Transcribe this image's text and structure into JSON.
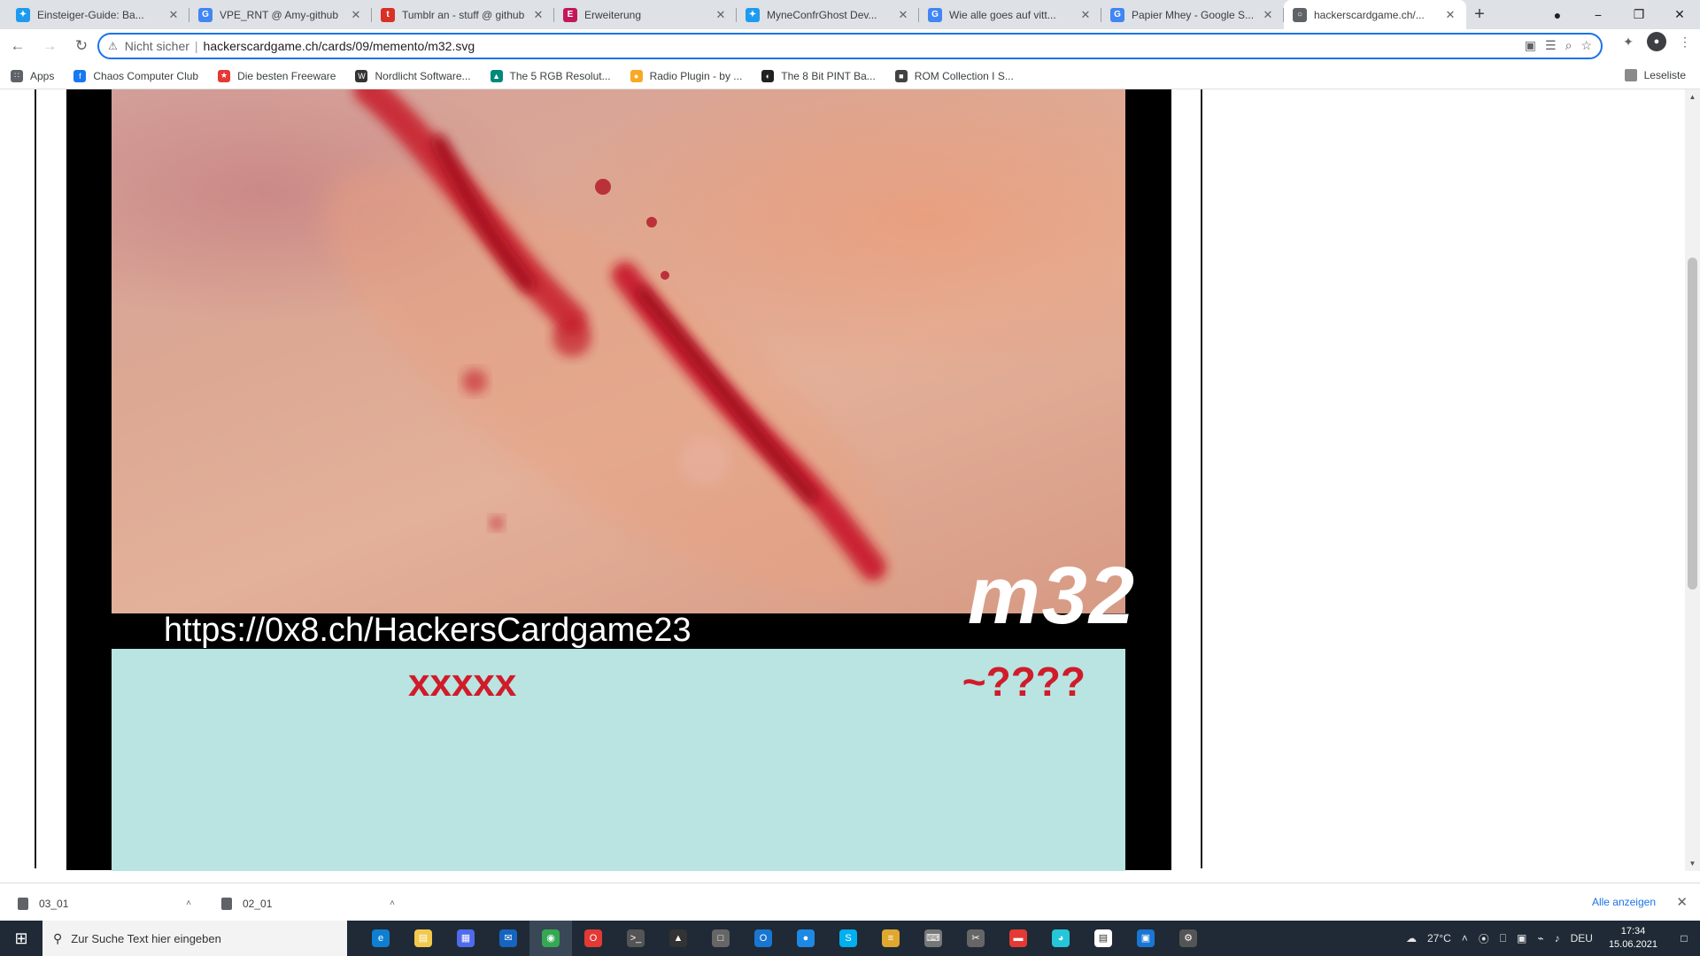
{
  "browser": {
    "tabs": [
      {
        "title": "Einsteiger-Guide: Ba...",
        "favicon_color": "#1d9bf0",
        "favicon_glyph": "✦",
        "active": false
      },
      {
        "title": "VPE_RNT @ Amy-github",
        "favicon_color": "#4285f4",
        "favicon_glyph": "G",
        "active": false
      },
      {
        "title": "Tumblr an - stuff @ github",
        "favicon_color": "#d93025",
        "favicon_glyph": "t",
        "active": false
      },
      {
        "title": "Erweiterung",
        "favicon_color": "#c2185b",
        "favicon_glyph": "E",
        "active": false
      },
      {
        "title": "MyneConfrGhost Dev...",
        "favicon_color": "#1d9bf0",
        "favicon_glyph": "✦",
        "active": false
      },
      {
        "title": "Wie alle goes auf vitt...",
        "favicon_color": "#4285f4",
        "favicon_glyph": "G",
        "active": false
      },
      {
        "title": "Papier Mhey - Google S...",
        "favicon_color": "#4285f4",
        "favicon_glyph": "G",
        "active": false
      },
      {
        "title": "hackerscardgame.ch/...",
        "favicon_color": "#5f6368",
        "favicon_glyph": "○",
        "active": true
      }
    ],
    "new_tab_glyph": "+",
    "window_controls": [
      "−",
      "❐",
      "✕"
    ],
    "nav": {
      "back": "←",
      "forward": "→",
      "reload": "↻"
    },
    "address": {
      "lock_glyph": "⚠",
      "security_label": "Nicht sicher",
      "separator": "|",
      "url": "hackerscardgame.ch/cards/09/memento/m32.svg"
    },
    "omnibox_icons": [
      "▣",
      "☰",
      "⌕",
      "☆"
    ],
    "toolbar_icons": [
      "✦",
      "●",
      "⋮"
    ],
    "bookmarks": [
      {
        "label": "Apps",
        "color": "#5f6368",
        "glyph": "∷"
      },
      {
        "label": "Chaos Computer Club",
        "color": "#1877f2",
        "glyph": "f"
      },
      {
        "label": "Die besten Freeware",
        "color": "#e53935",
        "glyph": "★"
      },
      {
        "label": "Nordlicht Software...",
        "color": "#333333",
        "glyph": "W"
      },
      {
        "label": "The 5 RGB Resolut...",
        "color": "#00897b",
        "glyph": "▲"
      },
      {
        "label": "Radio Plugin - by ...",
        "color": "#f9a825",
        "glyph": "●"
      },
      {
        "label": "The 8 Bit PINT Ba...",
        "color": "#212121",
        "glyph": "◐"
      },
      {
        "label": "ROM Collection I S...",
        "color": "#424242",
        "glyph": "■"
      }
    ],
    "bookmarks_right": "Leseliste"
  },
  "card": {
    "code": "m32",
    "url": "https://0x8.ch/HackersCardgame23",
    "info_left": "xxxxx",
    "info_right": "~????"
  },
  "downloads": [
    {
      "name": "03_01"
    },
    {
      "name": "02_01"
    }
  ],
  "downloads_show_all": "Alle anzeigen",
  "downloads_close": "✕",
  "taskbar": {
    "start_glyph": "⊞",
    "search_placeholder": "Zur Suche Text hier eingeben",
    "apps": [
      {
        "name": "edge",
        "color": "#0e7fd1",
        "glyph": "e"
      },
      {
        "name": "explorer",
        "color": "#f2c94c",
        "glyph": "▤"
      },
      {
        "name": "store",
        "color": "#4f6bed",
        "glyph": "▦"
      },
      {
        "name": "mail",
        "color": "#1565c0",
        "glyph": "✉"
      },
      {
        "name": "chrome",
        "color": "#34a853",
        "glyph": "◉"
      },
      {
        "name": "opera",
        "color": "#e53935",
        "glyph": "O"
      },
      {
        "name": "terminal",
        "color": "#555555",
        "glyph": ">_"
      },
      {
        "name": "dev",
        "color": "#333333",
        "glyph": "▲"
      },
      {
        "name": "vm",
        "color": "#666666",
        "glyph": "□"
      },
      {
        "name": "outlook",
        "color": "#1976d2",
        "glyph": "O"
      },
      {
        "name": "browser",
        "color": "#1e88e5",
        "glyph": "●"
      },
      {
        "name": "skype",
        "color": "#00aff0",
        "glyph": "S"
      },
      {
        "name": "notes",
        "color": "#e0a82e",
        "glyph": "≡"
      },
      {
        "name": "keyboard",
        "color": "#777777",
        "glyph": "⌨"
      },
      {
        "name": "tools",
        "color": "#666666",
        "glyph": "✂"
      },
      {
        "name": "media",
        "color": "#e53935",
        "glyph": "▬"
      },
      {
        "name": "chat",
        "color": "#26c6da",
        "glyph": "◕"
      },
      {
        "name": "doc",
        "color": "#ffffff",
        "glyph": "▤"
      },
      {
        "name": "window",
        "color": "#1976d2",
        "glyph": "▣"
      },
      {
        "name": "settings",
        "color": "#555555",
        "glyph": "⚙"
      }
    ],
    "temperature": "27°C",
    "language": "DEU",
    "time": "17:34",
    "date": "15.06.2021",
    "tray_icons": [
      "☁",
      "˄",
      "⦿",
      "⎕",
      "▣",
      "⌁",
      "♪"
    ]
  }
}
